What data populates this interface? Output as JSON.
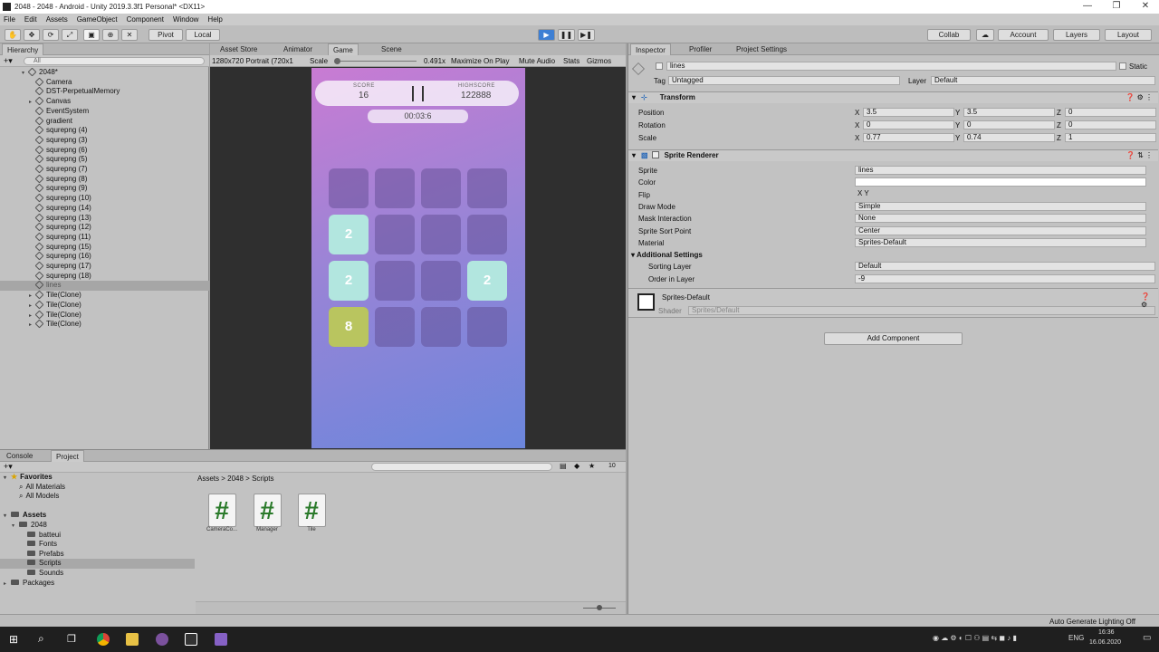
{
  "window": {
    "title": "2048 - 2048 - Android - Unity 2019.3.3f1 Personal* <DX11>",
    "controls": [
      "—",
      "❐",
      "✕"
    ]
  },
  "menu": [
    "File",
    "Edit",
    "Assets",
    "GameObject",
    "Component",
    "Window",
    "Help"
  ],
  "toolbar": {
    "pivot": "Pivot",
    "local": "Local",
    "collab": "Collab",
    "account": "Account",
    "layers": "Layers",
    "layout": "Layout"
  },
  "hierarchy": {
    "tab": "Hierarchy",
    "search_placeholder": "All",
    "scene": "2048*",
    "items": [
      "Camera",
      "DST-PerpetualMemory",
      "Canvas",
      "EventSystem",
      "gradient",
      "squrepng (4)",
      "squrepng (3)",
      "squrepng (6)",
      "squrepng (5)",
      "squrepng (7)",
      "squrepng (8)",
      "squrepng (9)",
      "squrepng (10)",
      "squrepng (14)",
      "squrepng (13)",
      "squrepng (12)",
      "squrepng (11)",
      "squrepng (15)",
      "squrepng (16)",
      "squrepng (17)",
      "squrepng (18)",
      "lines",
      "Tile(Clone)",
      "Tile(Clone)",
      "Tile(Clone)",
      "Tile(Clone)"
    ],
    "selected": "lines"
  },
  "game": {
    "tabs": [
      "Asset Store",
      "Animator",
      "Game",
      "Scene"
    ],
    "resolution": "1280x720 Portrait (720x1",
    "scale_label": "Scale",
    "scale_value": "0.491x",
    "maximize": "Maximize On Play",
    "mute": "Mute Audio",
    "stats": "Stats",
    "gizmos": "Gizmos",
    "score_label": "SCORE",
    "score": "16",
    "highscore_label": "HIGHSCORE",
    "highscore": "122888",
    "timer": "00:03:6",
    "tiles": [
      {
        "row": 1,
        "col": 0,
        "value": "2",
        "color": "#b2e6df"
      },
      {
        "row": 2,
        "col": 0,
        "value": "2",
        "color": "#b2e6df"
      },
      {
        "row": 2,
        "col": 3,
        "value": "2",
        "color": "#b2e6df"
      },
      {
        "row": 3,
        "col": 0,
        "value": "8",
        "color": "#b9c55f"
      }
    ]
  },
  "project": {
    "tabs": [
      "Console",
      "Project"
    ],
    "breadcrumb": [
      "Assets",
      "2048",
      "Scripts"
    ],
    "count": "10",
    "tree": [
      {
        "label": "Favorites",
        "indent": 0,
        "type": "star"
      },
      {
        "label": "All Materials",
        "indent": 1,
        "type": "search"
      },
      {
        "label": "All Models",
        "indent": 1,
        "type": "search"
      },
      {
        "label": "",
        "indent": 0,
        "type": "space"
      },
      {
        "label": "Assets",
        "indent": 0,
        "type": "folder"
      },
      {
        "label": "2048",
        "indent": 1,
        "type": "folder"
      },
      {
        "label": "batteui",
        "indent": 2,
        "type": "folder"
      },
      {
        "label": "Fonts",
        "indent": 2,
        "type": "folder"
      },
      {
        "label": "Prefabs",
        "indent": 2,
        "type": "folder"
      },
      {
        "label": "Scripts",
        "indent": 2,
        "type": "folder"
      },
      {
        "label": "Sounds",
        "indent": 2,
        "type": "folder"
      },
      {
        "label": "Packages",
        "indent": 0,
        "type": "folder"
      }
    ],
    "selected": "Scripts",
    "assets": [
      "CameraCo...",
      "Manager",
      "Tile"
    ]
  },
  "inspector": {
    "tabs": [
      "Inspector",
      "Profiler",
      "Project Settings"
    ],
    "name": "lines",
    "static": "Static",
    "tag_label": "Tag",
    "tag": "Untagged",
    "layer_label": "Layer",
    "layer": "Default",
    "transform": {
      "title": "Transform",
      "position_label": "Position",
      "position": [
        "3.5",
        "3.5",
        "0"
      ],
      "rotation_label": "Rotation",
      "rotation": [
        "0",
        "0",
        "0"
      ],
      "scale_label": "Scale",
      "scale": [
        "0.77",
        "0.74",
        "1"
      ]
    },
    "sprite_renderer": {
      "title": "Sprite Renderer",
      "fields": [
        {
          "label": "Sprite",
          "value": "lines"
        },
        {
          "label": "Color",
          "value": ""
        },
        {
          "label": "Flip",
          "value": "X  Y"
        },
        {
          "label": "Draw Mode",
          "value": "Simple"
        },
        {
          "label": "Mask Interaction",
          "value": "None"
        },
        {
          "label": "Sprite Sort Point",
          "value": "Center"
        },
        {
          "label": "Material",
          "value": "Sprites-Default"
        }
      ],
      "additional": "Additional Settings",
      "sorting_layer_label": "Sorting Layer",
      "sorting_layer": "Default",
      "order_label": "Order in Layer",
      "order": "-9"
    },
    "material": {
      "name": "Sprites-Default",
      "shader_label": "Shader",
      "shader": "Sprites/Default"
    },
    "add_component": "Add Component"
  },
  "status": {
    "right": "Auto Generate Lighting Off"
  },
  "taskbar": {
    "lang": "ENG",
    "time": "16:36",
    "date": "16.06.2020"
  }
}
